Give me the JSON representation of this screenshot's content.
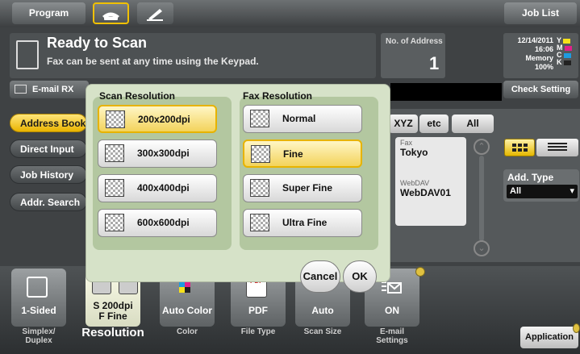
{
  "topbar": {
    "program_label": "Program",
    "fax_icon": "fax-handset-icon",
    "scan_icon": "scan-pen-icon",
    "job_list_label": "Job List"
  },
  "status": {
    "title": "Ready to Scan",
    "subtitle": "Fax can be sent at any time using the Keypad.",
    "address_label": "No. of Address",
    "address_count": "1",
    "date": "12/14/2011",
    "time": "16:06",
    "memory_label": "Memory",
    "memory_value": "100%",
    "toner": [
      {
        "letter": "Y",
        "color": "#f7e11a"
      },
      {
        "letter": "M",
        "color": "#e0218a"
      },
      {
        "letter": "C",
        "color": "#1e9be0"
      },
      {
        "letter": "K",
        "color": "#222222"
      }
    ]
  },
  "toolbar": {
    "email_rx_label": "E-mail RX",
    "check_setting_label": "Check Setting"
  },
  "sidebar": {
    "items": [
      {
        "label": "Address Book",
        "active": true
      },
      {
        "label": "Direct Input",
        "active": false
      },
      {
        "label": "Job History",
        "active": false
      },
      {
        "label": "Addr. Search",
        "active": false
      }
    ]
  },
  "address_list": {
    "tabs": [
      "XYZ",
      "etc",
      "All"
    ],
    "entries": [
      {
        "kind": "Fax",
        "name": "Tokyo"
      },
      {
        "kind": "WebDAV",
        "name": "WebDAV01"
      }
    ],
    "add_type_label": "Add. Type",
    "add_type_value": "All"
  },
  "popup": {
    "scan_resolution_title": "Scan Resolution",
    "scan_options": [
      {
        "label": "200x200dpi",
        "selected": true
      },
      {
        "label": "300x300dpi",
        "selected": false
      },
      {
        "label": "400x400dpi",
        "selected": false
      },
      {
        "label": "600x600dpi",
        "selected": false
      }
    ],
    "fax_resolution_title": "Fax Resolution",
    "fax_options": [
      {
        "label": "Normal",
        "selected": false
      },
      {
        "label": "Fine",
        "selected": true
      },
      {
        "label": "Super Fine",
        "selected": false
      },
      {
        "label": "Ultra Fine",
        "selected": false
      }
    ],
    "cancel_label": "Cancel",
    "ok_label": "OK"
  },
  "bottom": {
    "buttons": [
      {
        "value": "1-Sided",
        "label": "Simplex/\nDuplex"
      },
      {
        "value": "S 200dpi\nF Fine",
        "label": "Resolution"
      },
      {
        "value": "Auto Color",
        "label": "Color"
      },
      {
        "value": "PDF",
        "label": "File Type"
      },
      {
        "value": "Auto",
        "label": "Scan Size"
      },
      {
        "value": "ON",
        "label": "E-mail\nSettings"
      }
    ],
    "pdf_badge": "PDF",
    "application_label": "Application"
  }
}
